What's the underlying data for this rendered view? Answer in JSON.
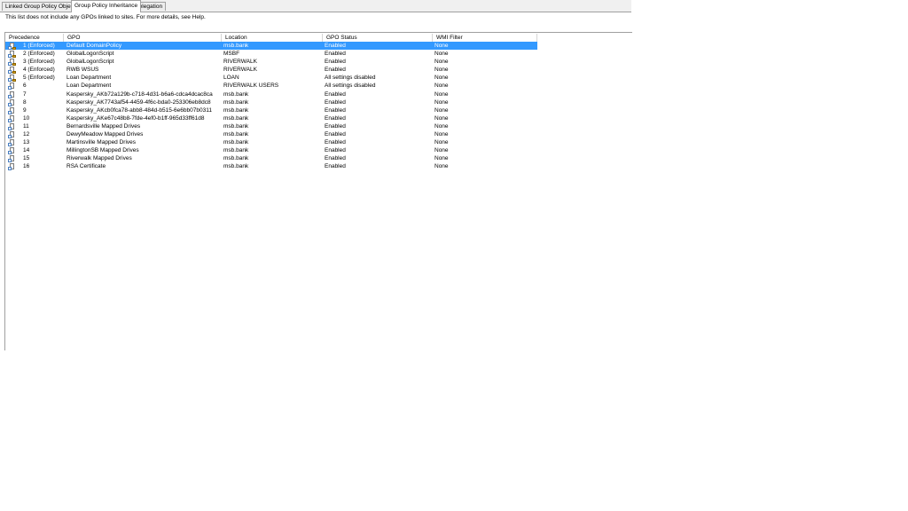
{
  "tabs": [
    {
      "label": "Linked Group Policy Objects",
      "active": false
    },
    {
      "label": "Group Policy Inheritance",
      "active": true
    },
    {
      "label": "Delegation",
      "active": false
    }
  ],
  "note": "This list does not include any GPOs linked to sites. For more details, see Help.",
  "columns": {
    "precedence": "Precedence",
    "gpo": "GPO",
    "location": "Location",
    "status": "GPO Status",
    "wmi": "WMI Filter"
  },
  "rows": [
    {
      "precedence": "1 (Enforced)",
      "gpo": "Default DomainPolicy",
      "location": "msb.bank",
      "status": "Enabled",
      "wmi": "None",
      "enforced": true,
      "selected": true
    },
    {
      "precedence": "2 (Enforced)",
      "gpo": "GlobalLogonScript",
      "location": "MSBF",
      "status": "Enabled",
      "wmi": "None",
      "enforced": true
    },
    {
      "precedence": "3 (Enforced)",
      "gpo": "GlobalLogonScript",
      "location": "RIVERWALK",
      "status": "Enabled",
      "wmi": "None",
      "enforced": true
    },
    {
      "precedence": "4 (Enforced)",
      "gpo": "RWB WSUS",
      "location": "RIVERWALK",
      "status": "Enabled",
      "wmi": "None",
      "enforced": true
    },
    {
      "precedence": "5 (Enforced)",
      "gpo": "Loan Department",
      "location": "LOAN",
      "status": "All settings disabled",
      "wmi": "None",
      "enforced": true
    },
    {
      "precedence": "6",
      "gpo": "Loan Department",
      "location": "RIVERWALK USERS",
      "status": "All settings disabled",
      "wmi": "None",
      "enforced": false
    },
    {
      "precedence": "7",
      "gpo": "Kaspersky_AKb72a129b-c718-4d31-b6a6-cdca4dcac8ca",
      "location": "msb.bank",
      "status": "Enabled",
      "wmi": "None",
      "enforced": false
    },
    {
      "precedence": "8",
      "gpo": "Kaspersky_AK7743af54-4459-4f6c-bda0-253306eb8dc8",
      "location": "msb.bank",
      "status": "Enabled",
      "wmi": "None",
      "enforced": false
    },
    {
      "precedence": "9",
      "gpo": "Kaspersky_AKcb0fca78-abb8-484d-b515-6e6bb07b0311",
      "location": "msb.bank",
      "status": "Enabled",
      "wmi": "None",
      "enforced": false
    },
    {
      "precedence": "10",
      "gpo": "Kaspersky_AKe67c48b8-7fde-4ef0-b1ff-965d33ff61d8",
      "location": "msb.bank",
      "status": "Enabled",
      "wmi": "None",
      "enforced": false
    },
    {
      "precedence": "11",
      "gpo": "Bernardsville Mapped Drives",
      "location": "msb.bank",
      "status": "Enabled",
      "wmi": "None",
      "enforced": false
    },
    {
      "precedence": "12",
      "gpo": "DewyMeadow Mapped Drives",
      "location": "msb.bank",
      "status": "Enabled",
      "wmi": "None",
      "enforced": false
    },
    {
      "precedence": "13",
      "gpo": "Martinsville Mapped Drives",
      "location": "msb.bank",
      "status": "Enabled",
      "wmi": "None",
      "enforced": false
    },
    {
      "precedence": "14",
      "gpo": "MillingtonSB Mapped Drives",
      "location": "msb.bank",
      "status": "Enabled",
      "wmi": "None",
      "enforced": false
    },
    {
      "precedence": "15",
      "gpo": "Riverwalk Mapped Drives",
      "location": "msb.bank",
      "status": "Enabled",
      "wmi": "None",
      "enforced": false
    },
    {
      "precedence": "16",
      "gpo": "RSA Certificate",
      "location": "msb.bank",
      "status": "Enabled",
      "wmi": "None",
      "enforced": false
    }
  ]
}
